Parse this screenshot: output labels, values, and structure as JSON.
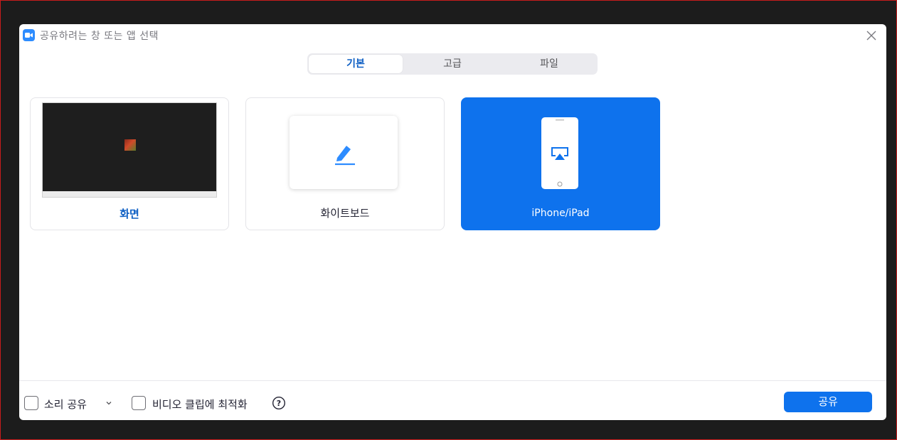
{
  "window": {
    "title": "공유하려는 창 또는 앱 선택"
  },
  "tabs": [
    {
      "label": "기본",
      "active": true
    },
    {
      "label": "고급",
      "active": false
    },
    {
      "label": "파일",
      "active": false
    }
  ],
  "cards": [
    {
      "label": "화면",
      "icon": "screen-thumbnail"
    },
    {
      "label": "화이트보드",
      "icon": "pen-icon"
    },
    {
      "label": "iPhone/iPad",
      "icon": "airplay-icon",
      "selected": true
    }
  ],
  "footer": {
    "share_sound": "소리 공유",
    "optimize_video": "비디오 클립에 최적화",
    "help_icon": "help-icon",
    "share_button": "공유"
  },
  "colors": {
    "accent": "#0e72ed",
    "selected_tab_text": "#0e5fc4",
    "backdrop": "#1c1c1c"
  }
}
